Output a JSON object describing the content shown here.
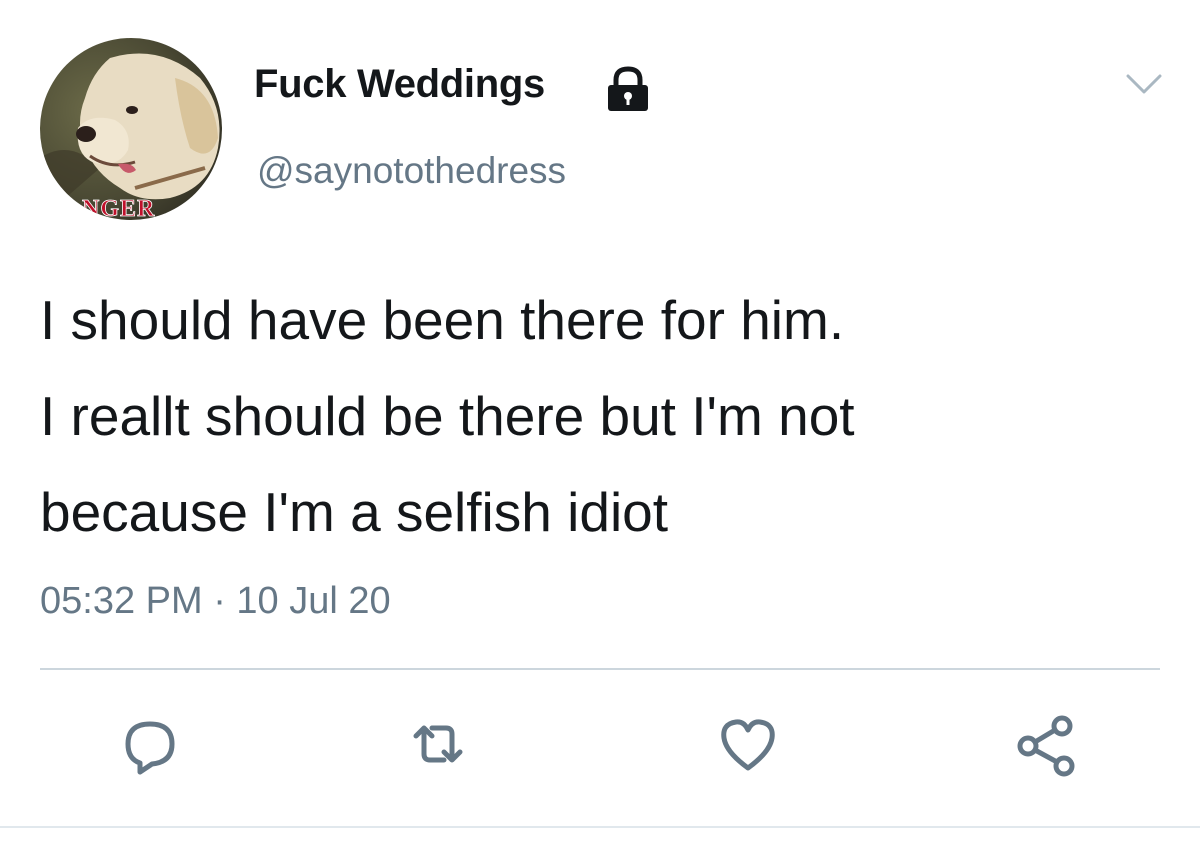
{
  "user": {
    "display_name": "Fuck Weddings",
    "handle": "@saynotothedress",
    "avatar_icon": "dog-avatar",
    "avatar_text": "NGER",
    "protected_icon": "lock-icon"
  },
  "tweet": {
    "lines": [
      "I should have been there for him.",
      "I reallt should be there but I'm not",
      "because I'm a selfish idiot"
    ],
    "timestamp": "05:32 PM · 10 Jul 20"
  },
  "actions": {
    "reply_icon": "reply-icon",
    "retweet_icon": "retweet-icon",
    "like_icon": "heart-icon",
    "share_icon": "share-icon",
    "menu_icon": "chevron-down-icon"
  },
  "colors": {
    "text": "#14171a",
    "secondary": "#657786",
    "divider": "#ccd6dd"
  }
}
